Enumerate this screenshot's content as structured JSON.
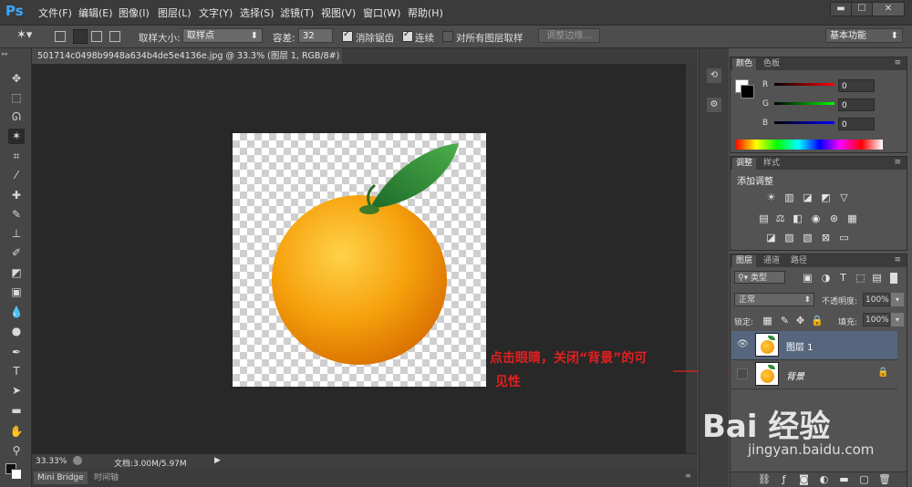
{
  "app": {
    "logo": "Ps"
  },
  "menu": [
    "文件(F)",
    "编辑(E)",
    "图像(I)",
    "图层(L)",
    "文字(Y)",
    "选择(S)",
    "滤镜(T)",
    "视图(V)",
    "窗口(W)",
    "帮助(H)"
  ],
  "window_buttons": [
    "▬",
    "☐",
    "✕"
  ],
  "options": {
    "sample_size_label": "取样大小:",
    "sample_size_value": "取样点",
    "tolerance_label": "容差:",
    "tolerance_value": "32",
    "antialias_label": "消除锯齿",
    "contiguous_label": "连续",
    "all_layers_label": "对所有图层取样",
    "refine_edge_label": "调整边缘...",
    "workspace_value": "基本功能"
  },
  "document": {
    "tab_title": "501714c0498b9948a634b4de5e4136e.jpg @ 33.3% (图层 1, RGB/8#) *",
    "tab_close": "×",
    "zoom": "33.33%",
    "doc_info": "文档:3.00M/5.97M"
  },
  "bottom_tabs": [
    "Mini Bridge",
    "时间轴"
  ],
  "annotation": {
    "line1": "点击眼睛，关闭“背景”的可",
    "line2": "见性"
  },
  "color_panel": {
    "tabs": [
      "颜色",
      "色板"
    ],
    "channels": [
      {
        "label": "R",
        "value": "0"
      },
      {
        "label": "G",
        "value": "0"
      },
      {
        "label": "B",
        "value": "0"
      }
    ]
  },
  "adjust_panel": {
    "tabs": [
      "调整",
      "样式"
    ],
    "title": "添加调整"
  },
  "layers_panel": {
    "tabs": [
      "图层",
      "通道",
      "路径"
    ],
    "filter_value": "类型",
    "blend_mode": "正常",
    "opacity_label": "不透明度:",
    "opacity_value": "100%",
    "lock_label": "锁定:",
    "fill_label": "填充:",
    "fill_value": "100%",
    "layers": [
      {
        "name": "图层 1",
        "visible": true,
        "selected": true
      },
      {
        "name": "背景",
        "visible": false,
        "selected": false,
        "locked": true
      }
    ]
  },
  "watermark": {
    "brand": "Bai 经验",
    "url": "jingyan.baidu.com"
  }
}
